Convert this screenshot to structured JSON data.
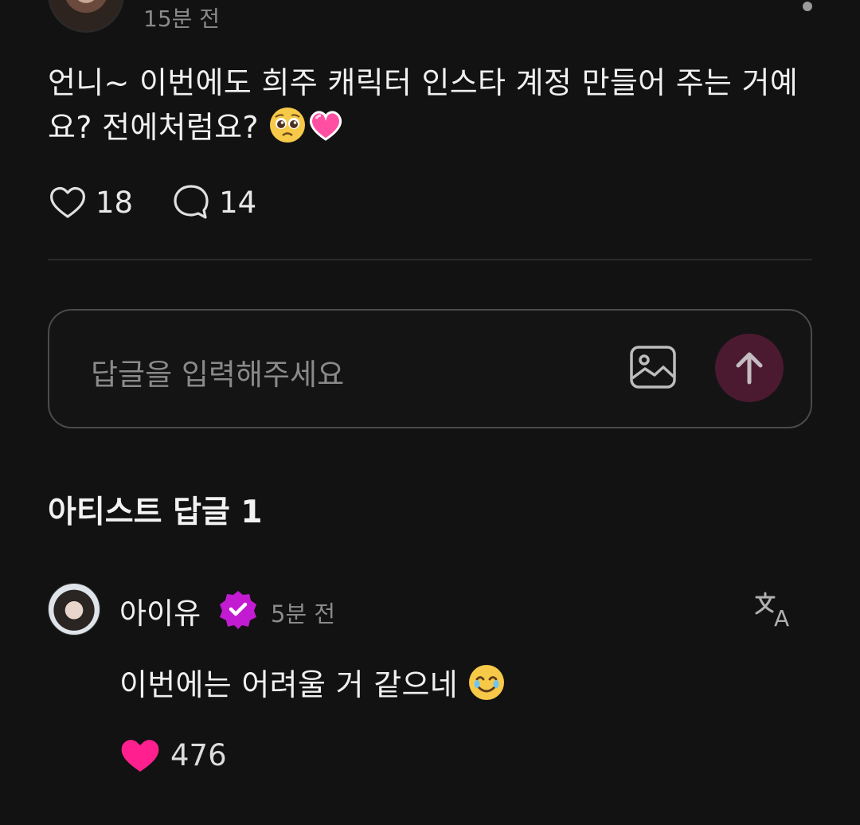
{
  "post": {
    "time": "15분 전",
    "body_text": "언니~ 이번에도 희주 캐릭터 인스타 계정 만들어 주는 거예요? 전에처럼요?",
    "emojis": [
      "pleading-face-emoji",
      "heart-emoji"
    ],
    "like_count": "18",
    "comment_count": "14"
  },
  "reply_input": {
    "placeholder": "답글을 입력해주세요"
  },
  "section": {
    "title": "아티스트 답글 1"
  },
  "artist_reply": {
    "author": "아이유",
    "time": "5분 전",
    "body_text": "이번에는 어려울 거 같으네",
    "emoji": "tearful-smile-emoji",
    "like_count": "476"
  },
  "colors": {
    "background": "#121212",
    "accent_pink": "#ff1f8e",
    "badge_purple": "#c21bd1",
    "send_button": "#4b1a30"
  }
}
